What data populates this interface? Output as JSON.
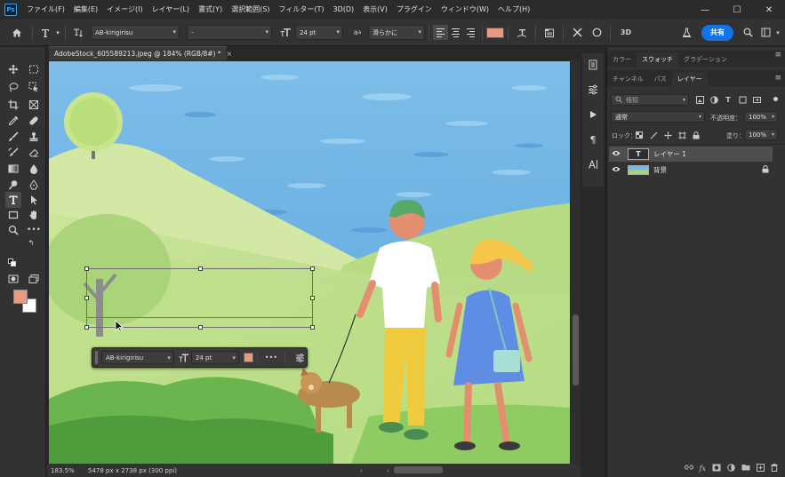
{
  "app": {
    "logo_text": "Ps",
    "menu": [
      "ファイル(F)",
      "編集(E)",
      "イメージ(I)",
      "レイヤー(L)",
      "書式(Y)",
      "選択範囲(S)",
      "フィルター(T)",
      "3D(D)",
      "表示(V)",
      "プラグイン",
      "ウィンドウ(W)",
      "ヘルプ(H)"
    ],
    "window_controls": [
      "—",
      "☐",
      "✕"
    ]
  },
  "options_bar": {
    "font_family": "AB-kirigirisu",
    "font_style": "-",
    "font_size": "24 pt",
    "aa_label": "a",
    "anti_alias": "滑らかに",
    "text_color": "#e89a82",
    "threed_label": "3D",
    "share_label": "共有"
  },
  "document": {
    "tab_title": "AdobeStock_605589213.jpeg @ 184% (RGB/8#) *",
    "tab_close": "×",
    "zoom": "183.5%",
    "dimensions": "5478 px x 2738 px (300 ppi)"
  },
  "task_bar": {
    "font_family": "AB-kirigirisu",
    "font_size": "24 pt",
    "color": "#e89a82",
    "more": "•••"
  },
  "colors": {
    "foreground": "#e89a82",
    "background": "#ffffff",
    "accent": "#1473e6"
  },
  "panels": {
    "top_tabs": [
      "カラー",
      "スウォッチ",
      "グラデーション"
    ],
    "top_active": 1,
    "layer_tabs": [
      "チャンネル",
      "パス",
      "レイヤー"
    ],
    "layer_active": 2,
    "filter_placeholder": "種類",
    "blend_mode": "通常",
    "opacity_label": "不透明度：",
    "opacity_value": "100%",
    "lock_label": "ロック：",
    "fill_label": "塗り：",
    "fill_value": "100%",
    "layers": [
      {
        "name": "レイヤー 1",
        "type": "text",
        "thumb_text": "T",
        "selected": true
      },
      {
        "name": "背景",
        "type": "image",
        "locked": true
      }
    ]
  }
}
